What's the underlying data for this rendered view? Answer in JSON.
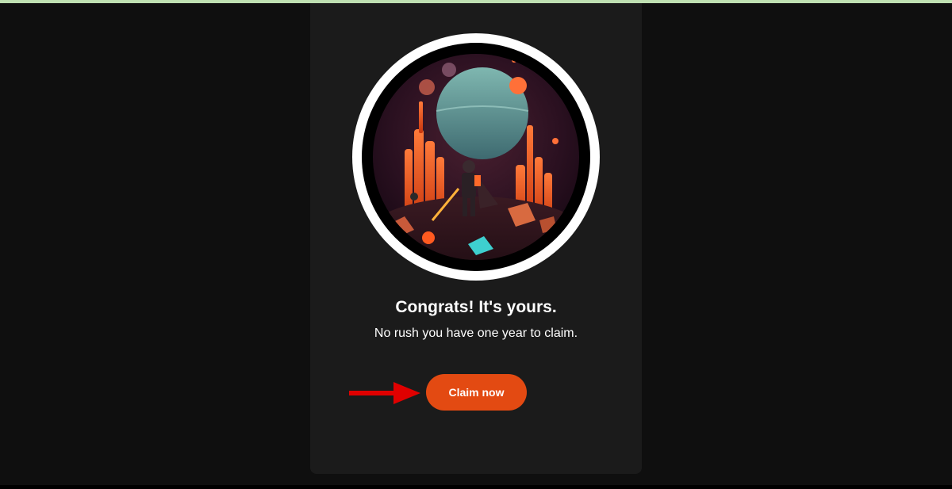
{
  "colors": {
    "page_background": "#0f0f0f",
    "card_background": "#1b1b1b",
    "top_strip": "#bfe0b2",
    "button_background": "#e34a12",
    "arrow": "#e00000"
  },
  "claim": {
    "title": "Congrats! It's yours.",
    "subtitle": "No rush you have one year to claim.",
    "button_label": "Claim now"
  },
  "icons": {
    "annotation_arrow": "arrow-right-icon"
  }
}
